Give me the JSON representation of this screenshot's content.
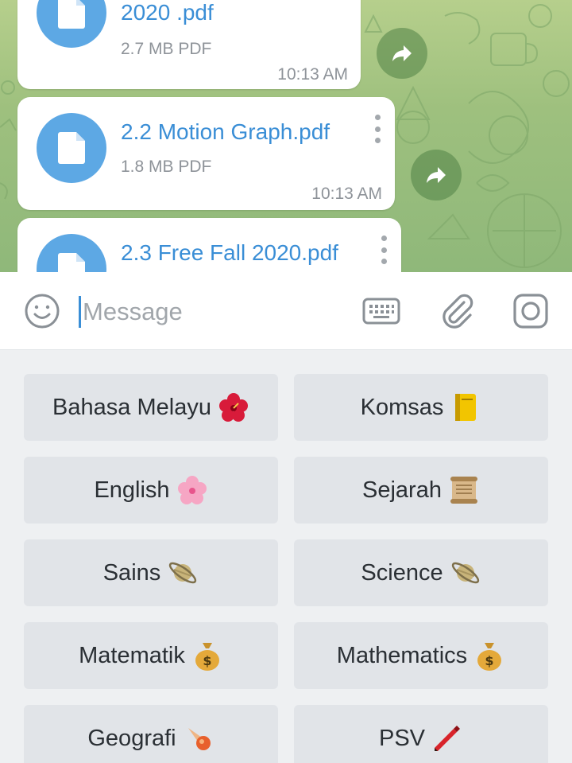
{
  "chat": {
    "messages": [
      {
        "name": "2020 .pdf",
        "size": "2.7 MB PDF",
        "time": "10:13 AM"
      },
      {
        "name": "2.2 Motion Graph.pdf",
        "size": "1.8 MB PDF",
        "time": "10:13 AM"
      },
      {
        "name": "2.3 Free Fall 2020.pdf",
        "size": "",
        "time": ""
      }
    ],
    "icons": {
      "file": "document-icon",
      "share": "forward-arrow-icon",
      "menu": "more-vertical-icon"
    },
    "colors": {
      "accent": "#3a8ed6",
      "file_icon_bg": "#5da8e4",
      "wallpaper": "#9ec07e"
    }
  },
  "input_bar": {
    "placeholder": "Message",
    "icons": [
      "emoji-icon",
      "keyboard-icon",
      "attach-icon",
      "camera-icon"
    ]
  },
  "keyboard": {
    "buttons": [
      {
        "label": "Bahasa Melayu",
        "emoji": "hibiscus"
      },
      {
        "label": "Komsas",
        "emoji": "ledger-book"
      },
      {
        "label": "English",
        "emoji": "cherry-blossom"
      },
      {
        "label": "Sejarah",
        "emoji": "scroll"
      },
      {
        "label": "Sains",
        "emoji": "ringed-planet"
      },
      {
        "label": "Science",
        "emoji": "ringed-planet"
      },
      {
        "label": "Matematik",
        "emoji": "money-bag"
      },
      {
        "label": "Mathematics",
        "emoji": "money-bag"
      },
      {
        "label": "Geografi",
        "emoji": "comet"
      },
      {
        "label": "PSV",
        "emoji": "crayon"
      }
    ]
  }
}
